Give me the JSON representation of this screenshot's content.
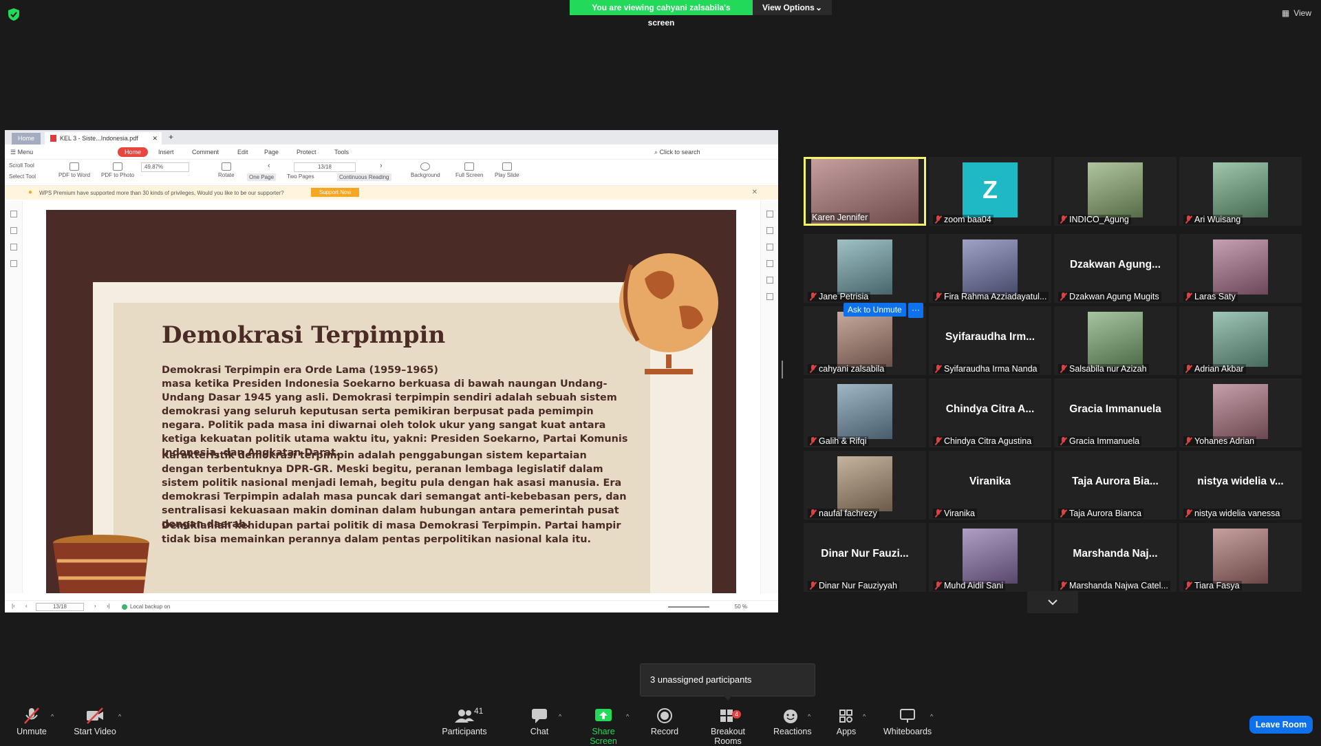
{
  "meeting": {
    "banner_text": "You are viewing cahyani zalsabila's screen",
    "view_options_label": "View Options",
    "top_view_label": "View"
  },
  "wps": {
    "tab_home": "Home",
    "tab_doc": "KEL 3 - Siste...Indonesia.pdf",
    "menu": {
      "menu": "Menu",
      "home": "Home",
      "insert": "Insert",
      "comment": "Comment",
      "edit": "Edit",
      "page": "Page",
      "protect": "Protect",
      "tools": "Tools",
      "search": "Click to search"
    },
    "toolbar": {
      "scroll_tool": "Scroll Tool",
      "select_tool": "Select Tool",
      "pdf_to_word": "PDF to Word",
      "pdf_to_photo": "PDF to Photo",
      "zoom": "49.87%",
      "rotate": "Rotate",
      "one_page": "One Page",
      "two_pages": "Two Pages",
      "continuous_reading": "Continuous Reading",
      "page_indicator": "13/18",
      "background": "Background",
      "full_screen": "Full Screen",
      "play_slide": "Play Slide"
    },
    "notice": {
      "text": "WPS Premium have supported more than 30 kinds of privileges, Would you like to be our supporter?",
      "button": "Support Now"
    },
    "status": {
      "page": "13/18",
      "backup": "Local backup on",
      "zoom": "50 %"
    }
  },
  "slide": {
    "title": "Demokrasi Terpimpin",
    "para1": "Demokrasi Terpimpin era Orde Lama (1959–1965)\nmasa ketika Presiden Indonesia Soekarno berkuasa di bawah naungan Undang-Undang Dasar 1945 yang asli. Demokrasi terpimpin sendiri adalah sebuah sistem demokrasi yang seluruh keputusan serta pemikiran berpusat pada pemimpin negara. Politik pada masa ini diwarnai oleh tolok ukur yang sangat kuat antara ketiga kekuatan politik utama waktu itu, yakni: Presiden Soekarno, Partai Komunis Indonesia, dan Angkatan Darat.",
    "para2": "Karakteristik demokrasi terpimpin adalah penggabungan sistem kepartaian dengan terbentuknya DPR-GR. Meski begitu, peranan lembaga legislatif dalam sistem politik nasional menjadi lemah, begitu pula dengan hak asasi manusia. Era demokrasi Terpimpin adalah masa puncak dari semangat anti-kebebasan pers, dan sentralisasi kekuasaan  makin dominan dalam hubungan antara pemerintah pusat dengan daerah.",
    "para3": "Demikianlah kehidupan partai politik di masa Demokrasi Terpimpin. Partai hampir tidak bisa memainkan perannya dalam pentas perpolitikan nasional kala itu."
  },
  "participants": [
    {
      "name": "Karen Jennifer",
      "big": "",
      "video": true,
      "muted": false
    },
    {
      "name": "zoom baa04",
      "big": "",
      "video": false,
      "muted": true
    },
    {
      "name": "INDICO_Agung",
      "big": "",
      "video": true,
      "muted": true
    },
    {
      "name": "Ari Wuisang",
      "big": "",
      "video": true,
      "muted": true
    },
    {
      "name": "Jane Petrisia",
      "big": "",
      "video": true,
      "muted": true
    },
    {
      "name": "Fira Rahma Azziadayatul...",
      "big": "",
      "video": true,
      "muted": true
    },
    {
      "name": "Dzakwan Agung Mugits",
      "big": "Dzakwan  Agung...",
      "video": false,
      "muted": true
    },
    {
      "name": "Laras Saty",
      "big": "",
      "video": true,
      "muted": true
    },
    {
      "name": "cahyani zalsabila",
      "big": "",
      "video": true,
      "muted": true
    },
    {
      "name": "Syifaraudha Irma Nanda",
      "big": "Syifaraudha  Irm...",
      "video": false,
      "muted": true
    },
    {
      "name": "Salsabila nur Azizah",
      "big": "",
      "video": true,
      "muted": true
    },
    {
      "name": "Adrian Akbar",
      "big": "",
      "video": true,
      "muted": true
    },
    {
      "name": "Galih & Rifqi",
      "big": "",
      "video": true,
      "muted": true
    },
    {
      "name": "Chindya Citra Agustina",
      "big": "Chindya Citra A...",
      "video": false,
      "muted": true
    },
    {
      "name": "Gracia Immanuela",
      "big": "Gracia  Immanuela",
      "video": false,
      "muted": true
    },
    {
      "name": "Yohanes Adrian",
      "big": "",
      "video": true,
      "muted": true
    },
    {
      "name": "naufal fachrezy",
      "big": "",
      "video": true,
      "muted": true
    },
    {
      "name": "Viranika",
      "big": "Viranika",
      "video": false,
      "muted": true
    },
    {
      "name": "Taja Aurora Bianca",
      "big": "Taja Aurora Bia...",
      "video": false,
      "muted": true
    },
    {
      "name": "nistya widelia vanessa",
      "big": "nistya  widelia  v...",
      "video": false,
      "muted": true
    },
    {
      "name": "Dinar Nur Fauziyyah",
      "big": "Dinar Nur Fauzi...",
      "video": false,
      "muted": true
    },
    {
      "name": "Muhd Aidil Sani",
      "big": "",
      "video": true,
      "muted": true
    },
    {
      "name": "Marshanda Najwa Catel...",
      "big": "Marshanda  Naj...",
      "video": false,
      "muted": true
    },
    {
      "name": "Tiara Fasya",
      "big": "",
      "video": true,
      "muted": true
    }
  ],
  "ask_unmute": "Ask to Unmute",
  "more_label": "···",
  "unassigned": "3 unassigned participants",
  "bottombar": {
    "unmute": "Unmute",
    "start_video": "Start Video",
    "participants": "Participants",
    "participants_count": "41",
    "chat": "Chat",
    "share_screen": "Share Screen",
    "record": "Record",
    "breakout_rooms": "Breakout Rooms",
    "breakout_badge": "4",
    "reactions": "Reactions",
    "apps": "Apps",
    "whiteboards": "Whiteboards",
    "leave_room": "Leave Room"
  },
  "colors": {
    "accent": "#0e72ed",
    "banner": "#23d959",
    "active_speaker": "#f5f56a",
    "muted": "#e04040",
    "slide_dark": "#4a2b26",
    "slide_paper": "#e8dbc6"
  }
}
